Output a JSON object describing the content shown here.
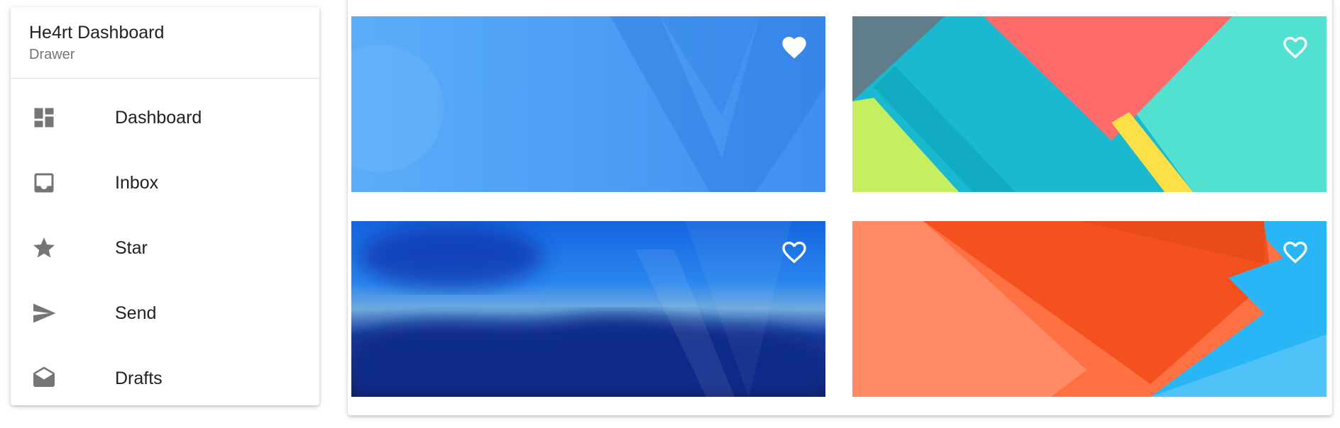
{
  "drawer": {
    "title": "He4rt Dashboard",
    "subtitle": "Drawer",
    "items": [
      {
        "label": "Dashboard",
        "icon": "dashboard-icon"
      },
      {
        "label": "Inbox",
        "icon": "inbox-icon"
      },
      {
        "label": "Star",
        "icon": "star-icon"
      },
      {
        "label": "Send",
        "icon": "send-icon"
      },
      {
        "label": "Drafts",
        "icon": "drafts-icon"
      }
    ]
  },
  "cards": [
    {
      "theme": "vuetify blue",
      "favorite": true,
      "heart_icon": "favorite-icon"
    },
    {
      "theme": "material geometric",
      "favorite": false,
      "heart_icon": "favorite-border-icon"
    },
    {
      "theme": "blurred dark blue",
      "favorite": false,
      "heart_icon": "favorite-border-icon"
    },
    {
      "theme": "orange blue polygons",
      "favorite": false,
      "heart_icon": "favorite-border-icon"
    }
  ],
  "colors": {
    "icon_gray": "#757575",
    "text_primary": "#212121",
    "text_secondary": "#757575",
    "divider": "#e0e0e0"
  }
}
